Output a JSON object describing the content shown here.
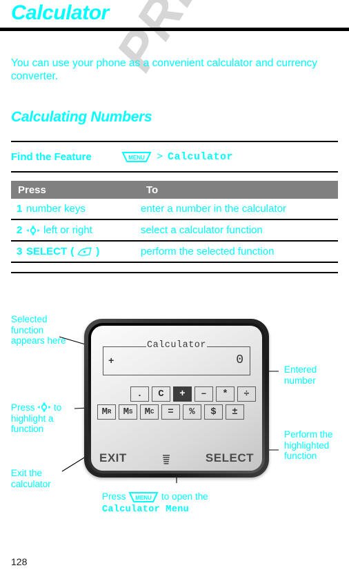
{
  "watermark": "PRELIMINARY",
  "chapter": {
    "title": "Calculator"
  },
  "intro": {
    "text": "You can use your phone as a convenient calculator and currency converter."
  },
  "section": {
    "heading": "Calculating Numbers"
  },
  "find_the_feature": {
    "label": "Find the Feature",
    "menu_key_label": "MENU",
    "separator": ">",
    "target": "Calculator"
  },
  "steps_table": {
    "headers": {
      "press": "Press",
      "to": "To"
    },
    "rows": [
      {
        "num": "1",
        "press": "number keys",
        "to": "enter a number in the calculator",
        "icon": "",
        "bold": false
      },
      {
        "num": "2",
        "press": "left or right",
        "to": "select a calculator function",
        "icon": "nav-key-icon",
        "bold": false
      },
      {
        "num": "3",
        "press": "SELECT",
        "press_suffix_open": "(",
        "press_suffix_close": ")",
        "to": "perform the selected function",
        "icon": "select-key-icon",
        "bold": true
      }
    ]
  },
  "illustration": {
    "display": {
      "legend": "Calculator",
      "operator": "+",
      "value": "0"
    },
    "keypad": {
      "row1": [
        {
          "label": ".",
          "selected": false
        },
        {
          "label": "C",
          "selected": false
        },
        {
          "label": "+",
          "selected": true
        },
        {
          "label": "–",
          "selected": false
        },
        {
          "label": "*",
          "selected": false
        },
        {
          "label": "÷",
          "selected": false
        }
      ],
      "row2": [
        {
          "label": "M",
          "sup": "R",
          "selected": false
        },
        {
          "label": "M",
          "sup": "S",
          "selected": false
        },
        {
          "label": "M",
          "sup": "C",
          "selected": false
        },
        {
          "label": "=",
          "sup": "",
          "selected": false
        },
        {
          "label": "%",
          "sup": "",
          "selected": false
        },
        {
          "label": "$",
          "sup": "",
          "selected": false
        },
        {
          "label": "±",
          "sup": "",
          "selected": false
        }
      ]
    },
    "softkeys": {
      "left": "EXIT",
      "center_icon": "menu-list-icon",
      "right": "SELECT"
    },
    "callouts": {
      "selected_function": "Selected function appears here",
      "press_to_highlight_pre": "Press",
      "press_to_highlight_post": "to highlight a function",
      "exit": "Exit the calculator",
      "entered_number": "Entered number",
      "perform": "Perform the highlighted function",
      "bottom_pre": "Press",
      "bottom_mid": "to open the",
      "bottom_menu_name": "Calculator Menu",
      "bottom_menu_key": "MENU"
    }
  },
  "footer": {
    "page_number": "128"
  },
  "colors": {
    "accent": "#00ffff",
    "rule": "#000000",
    "table_header_bg": "#808080",
    "watermark": "#d6d6d6",
    "key_selected_bg": "#3d3d3d"
  }
}
